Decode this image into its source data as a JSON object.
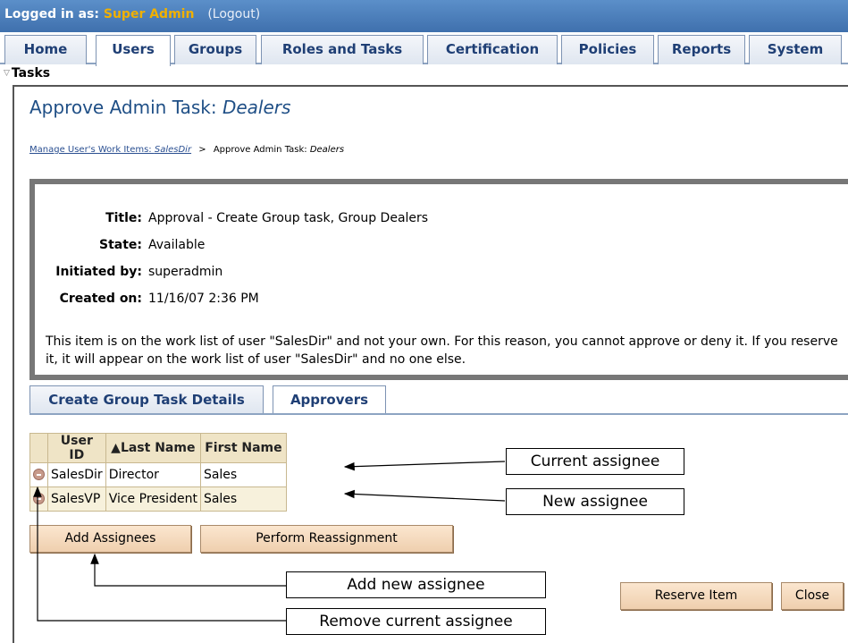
{
  "header": {
    "logged_in_label": "Logged in as:",
    "user": "Super Admin",
    "logout": "(Logout)"
  },
  "tabs": [
    {
      "label": "Home"
    },
    {
      "label": "Users",
      "active": true
    },
    {
      "label": "Groups"
    },
    {
      "label": "Roles and Tasks"
    },
    {
      "label": "Certification"
    },
    {
      "label": "Policies"
    },
    {
      "label": "Reports"
    },
    {
      "label": "System"
    }
  ],
  "section": "Tasks",
  "page": {
    "title_prefix": "Approve Admin Task: ",
    "title_name": "Dealers"
  },
  "breadcrumb": {
    "link_prefix": "Manage User's Work Items: ",
    "link_name": "SalesDir",
    "separator": ">",
    "current_prefix": "Approve Admin Task: ",
    "current_name": "Dealers"
  },
  "info": {
    "title_label": "Title:",
    "title_value": "Approval - Create Group task, Group Dealers",
    "state_label": "State:",
    "state_value": "Available",
    "initiated_label": "Initiated by:",
    "initiated_value": "superadmin",
    "created_label": "Created on:",
    "created_value": "11/16/07 2:36 PM",
    "notice": "This item is on the work list of user \"SalesDir\" and not your own. For this reason, you cannot approve or deny it. If you reserve it, it will appear on the work list of user \"SalesDir\" and no one else."
  },
  "subtabs": {
    "details": "Create Group Task Details",
    "approvers": "Approvers"
  },
  "table": {
    "columns": [
      "User ID",
      "▲Last Name",
      "First Name"
    ],
    "rows": [
      [
        "SalesDir",
        "Director",
        "Sales"
      ],
      [
        "SalesVP",
        "Vice President",
        "Sales"
      ]
    ]
  },
  "buttons": {
    "add_assignees": "Add Assignees",
    "perform_reassignment": "Perform Reassignment",
    "reserve_item": "Reserve Item",
    "close": "Close"
  },
  "callouts": {
    "current": "Current assignee",
    "new": "New assignee",
    "add": "Add new assignee",
    "remove": "Remove current assignee"
  }
}
